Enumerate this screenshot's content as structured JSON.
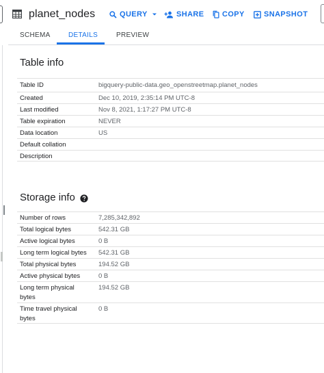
{
  "header": {
    "title": "planet_nodes",
    "query_label": "QUERY",
    "share_label": "SHARE",
    "copy_label": "COPY",
    "snapshot_label": "SNAPSHOT"
  },
  "tabs": [
    {
      "label": "SCHEMA"
    },
    {
      "label": "DETAILS"
    },
    {
      "label": "PREVIEW"
    }
  ],
  "table_info": {
    "heading": "Table info",
    "rows": [
      {
        "key": "Table ID",
        "value": "bigquery-public-data.geo_openstreetmap.planet_nodes"
      },
      {
        "key": "Created",
        "value": "Dec 10, 2019, 2:35:14 PM UTC-8"
      },
      {
        "key": "Last modified",
        "value": "Nov 8, 2021, 1:17:27 PM UTC-8"
      },
      {
        "key": "Table expiration",
        "value": "NEVER"
      },
      {
        "key": "Data location",
        "value": "US"
      },
      {
        "key": "Default collation",
        "value": ""
      },
      {
        "key": "Description",
        "value": ""
      }
    ]
  },
  "storage_info": {
    "heading": "Storage info",
    "rows": [
      {
        "key": "Number of rows",
        "value": "7,285,342,892"
      },
      {
        "key": "Total logical bytes",
        "value": "542.31 GB"
      },
      {
        "key": "Active logical bytes",
        "value": "0 B"
      },
      {
        "key": "Long term logical bytes",
        "value": "542.31 GB"
      },
      {
        "key": "Total physical bytes",
        "value": "194.52 GB"
      },
      {
        "key": "Active physical bytes",
        "value": "0 B"
      },
      {
        "key": "Long term physical",
        "key2": "bytes",
        "value": "194.52 GB"
      },
      {
        "key": "Time travel physical",
        "key2": "bytes",
        "value": "0 B"
      }
    ]
  },
  "icons": {
    "table": "table-grid-icon",
    "query": "search-icon",
    "query_dropdown": "caret-down-icon",
    "share": "person-add-icon",
    "copy": "copy-icon",
    "snapshot": "snapshot-icon",
    "help": "help-circle-icon"
  },
  "colors": {
    "accent": "#1a73e8",
    "text": "#202124",
    "muted": "#5f6368",
    "divider": "#e0e0e0"
  }
}
